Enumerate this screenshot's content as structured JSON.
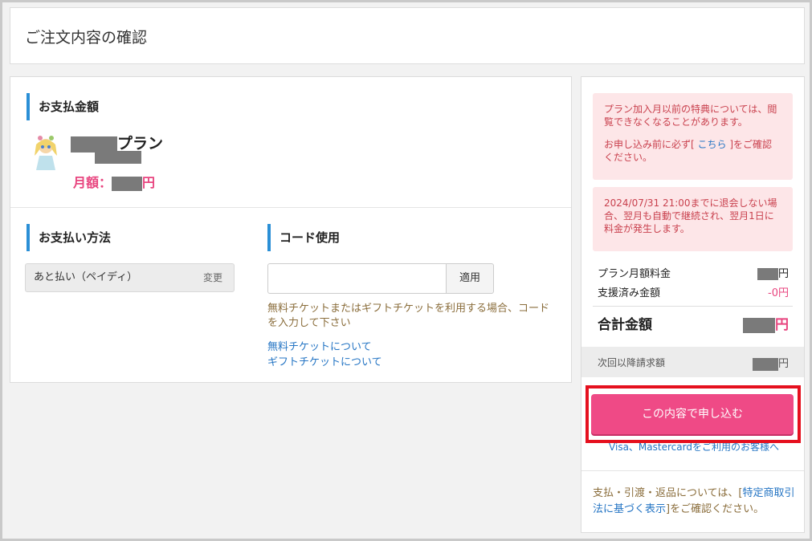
{
  "page": {
    "title": "ご注文内容の確認"
  },
  "payment_amount": {
    "heading": "お支払金額",
    "plan_suffix": "プラン",
    "monthly_label": "月額：",
    "currency": "円"
  },
  "payment_method": {
    "heading": "お支払い方法",
    "current": "あと払い（ペイディ）",
    "change_label": "変更"
  },
  "code": {
    "heading": "コード使用",
    "input_value": "",
    "apply_label": "適用",
    "note": "無料チケットまたはギフトチケットを利用する場合、コードを入力して下さい",
    "link_free": "無料チケットについて",
    "link_gift": "ギフトチケットについて"
  },
  "side": {
    "notice1_a": "プラン加入月以前の特典については、閲覧できなくなることがあります。",
    "notice1_b_pre": "お申し込み前に必ず[",
    "notice1_link": "こちら",
    "notice1_b_post": "]をご確認ください。",
    "notice2": "2024/07/31 21:00までに退会しない場合、翌月も自動で継続され、翌月1日に料金が発生します。",
    "plan_fee_label": "プラン月額料金",
    "plan_fee_unit": "円",
    "support_label": "支援済み金額",
    "support_value": "-0円",
    "total_label": "合計金額",
    "total_unit": "円",
    "next_label": "次回以降請求額",
    "next_unit": "円",
    "cta_label": "この内容で申し込む",
    "card_note": "Visa、Mastercardをご利用のお客様へ",
    "legal_pre": "支払・引渡・返品については、[",
    "legal_link": "特定商取引法に基づく表示",
    "legal_post": "]をご確認ください。"
  },
  "colors": {
    "accent": "#2a8fd6",
    "pink": "#ef4a86",
    "highlight": "#e5101e"
  }
}
